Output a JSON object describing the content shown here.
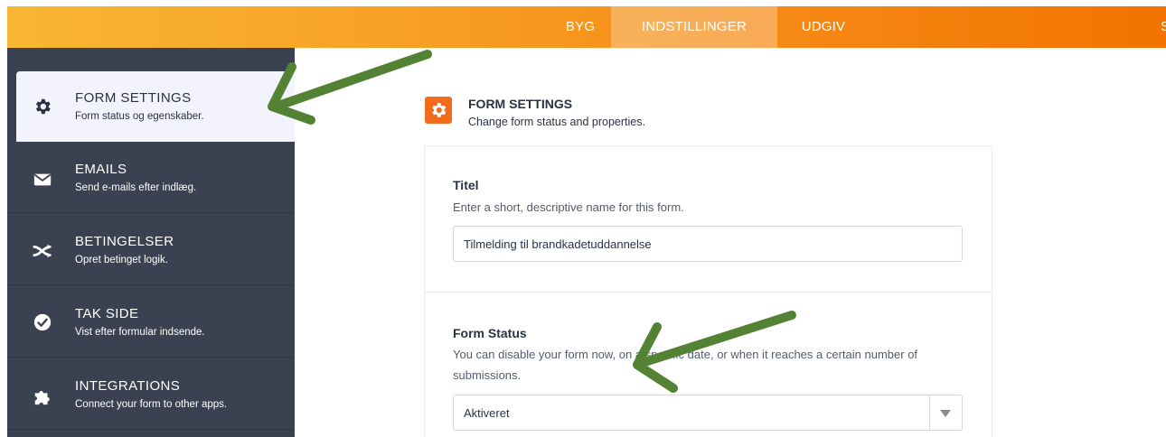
{
  "header": {
    "tabs": [
      {
        "label": "BYG"
      },
      {
        "label": "INDSTILLINGER"
      },
      {
        "label": "UDGIV"
      }
    ],
    "active_tab": "INDSTILLINGER",
    "clipped_text": "S"
  },
  "sidebar": {
    "items": [
      {
        "title": "FORM SETTINGS",
        "subtitle": "Form status og egenskaber.",
        "icon": "gear-icon"
      },
      {
        "title": "EMAILS",
        "subtitle": "Send e-mails efter indlæg.",
        "icon": "envelope-icon"
      },
      {
        "title": "BETINGELSER",
        "subtitle": "Opret betinget logik.",
        "icon": "shuffle-icon"
      },
      {
        "title": "TAK SIDE",
        "subtitle": "Vist efter formular indsende.",
        "icon": "check-circle-icon"
      },
      {
        "title": "INTEGRATIONS",
        "subtitle": "Connect your form to other apps.",
        "icon": "puzzle-icon"
      }
    ]
  },
  "main": {
    "section_title": "FORM SETTINGS",
    "section_subtitle": "Change form status and properties.",
    "title_field": {
      "label": "Titel",
      "description": "Enter a short, descriptive name for this form.",
      "value": "Tilmelding til brandkadetuddannelse"
    },
    "status_field": {
      "label": "Form Status",
      "description": "You can disable your form now, on a specific date, or when it reaches a certain number of submissions.",
      "value": "Aktiveret"
    }
  },
  "colors": {
    "accent": "#f06b1c",
    "sidebar_bg": "#3a4150",
    "annotation_arrow": "#548235"
  }
}
